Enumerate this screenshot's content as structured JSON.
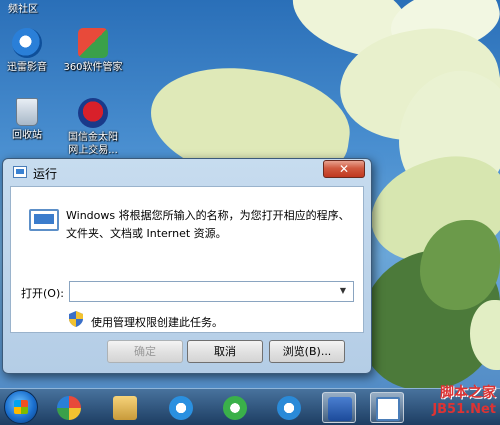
{
  "desktop": {
    "top_label": "频社区",
    "icons": [
      {
        "label": "迅雷影音",
        "icon": "xunlei-player-icon"
      },
      {
        "label": "360软件管家",
        "icon": "360-software-manager-icon"
      },
      {
        "label": "回收站",
        "icon": "recycle-bin-icon"
      },
      {
        "label": "国信金太阳网上交易",
        "line1": "国信金太阳",
        "line2": "网上交易...",
        "icon": "guoxin-trading-icon"
      }
    ]
  },
  "dialog": {
    "title": "运行",
    "close_glyph": "✕",
    "description": "Windows 将根据您所输入的名称，为您打开相应的程序、文件夹、文档或 Internet 资源。",
    "open_label": "打开(O):",
    "open_value": "",
    "admin_note": "使用管理权限创建此任务。",
    "buttons": {
      "ok": "确定",
      "cancel": "取消",
      "browse": "浏览(B)..."
    }
  },
  "taskbar": {
    "items": [
      "start-button",
      "360-icon",
      "explorer-icon",
      "cloud-icon",
      "sync-icon",
      "k-icon",
      "word-icon",
      "run-icon"
    ]
  },
  "watermark": {
    "line1": "脚本之家",
    "line2": "JB51.Net"
  },
  "colors": {
    "dialog_frame": "#b4cde6",
    "close_button": "#c03820",
    "taskbar": "#1e3a5a"
  }
}
